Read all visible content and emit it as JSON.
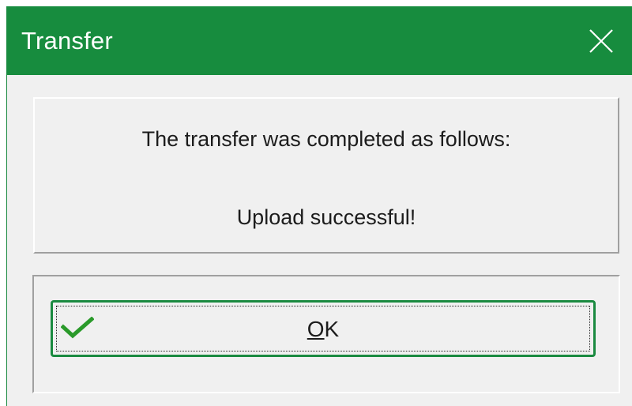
{
  "window": {
    "title": "Transfer"
  },
  "titlebar": {
    "close_icon": "close-icon",
    "accent_color": "#178c3e"
  },
  "message": {
    "line1": "The transfer was completed as follows:",
    "line2": "Upload successful!"
  },
  "buttons": {
    "ok": {
      "mnemonic": "O",
      "rest": "K",
      "icon": "checkmark-icon",
      "icon_color": "#2a9a2a"
    }
  }
}
